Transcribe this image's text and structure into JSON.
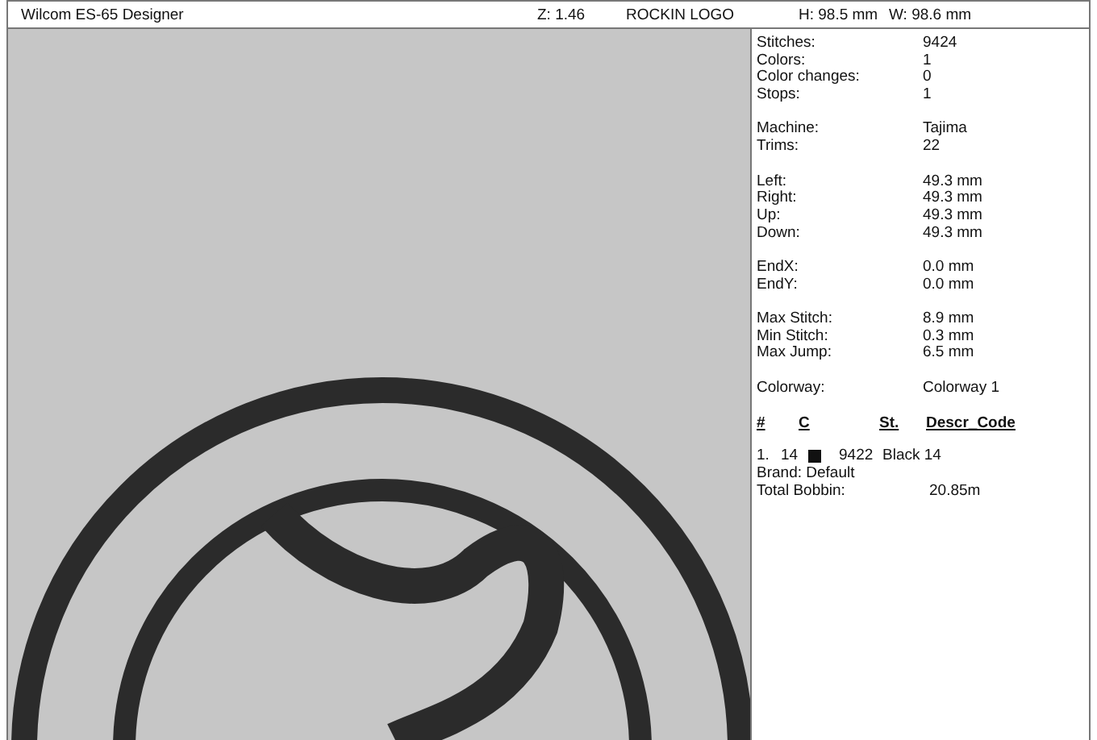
{
  "header": {
    "title": "Wilcom ES-65 Designer",
    "zoom": "Z: 1.46",
    "design_name": "ROCKIN LOGO",
    "height": "H: 98.5 mm",
    "width": "W: 98.6 mm"
  },
  "stats": [
    [
      {
        "label": "Stitches:",
        "value": "9424"
      },
      {
        "label": "Colors:",
        "value": "1"
      },
      {
        "label": "Color changes:",
        "value": "0"
      },
      {
        "label": "Stops:",
        "value": "1"
      }
    ],
    [
      {
        "label": "Machine:",
        "value": "Tajima"
      },
      {
        "label": "Trims:",
        "value": "22"
      }
    ],
    [
      {
        "label": "Left:",
        "value": "49.3 mm"
      },
      {
        "label": "Right:",
        "value": "49.3 mm"
      },
      {
        "label": "Up:",
        "value": "49.3 mm"
      },
      {
        "label": "Down:",
        "value": "49.3 mm"
      }
    ],
    [
      {
        "label": "EndX:",
        "value": "0.0 mm"
      },
      {
        "label": "EndY:",
        "value": "0.0 mm"
      }
    ],
    [
      {
        "label": "Max Stitch:",
        "value": "8.9 mm"
      },
      {
        "label": "Min Stitch:",
        "value": "0.3 mm"
      },
      {
        "label": "Max Jump:",
        "value": "6.5 mm"
      }
    ],
    [
      {
        "label": "Colorway:",
        "value": "Colorway 1"
      }
    ]
  ],
  "color_table": {
    "columns": [
      "#",
      "C",
      "St.",
      "Descr_Code"
    ],
    "rows": [
      {
        "index": "1.",
        "code": "14",
        "color": "#111111",
        "stitches": "9422",
        "description": "Black 14"
      }
    ]
  },
  "brand": "Brand: Default",
  "total_bobbin": {
    "label": "Total Bobbin:",
    "value": "20.85m"
  }
}
